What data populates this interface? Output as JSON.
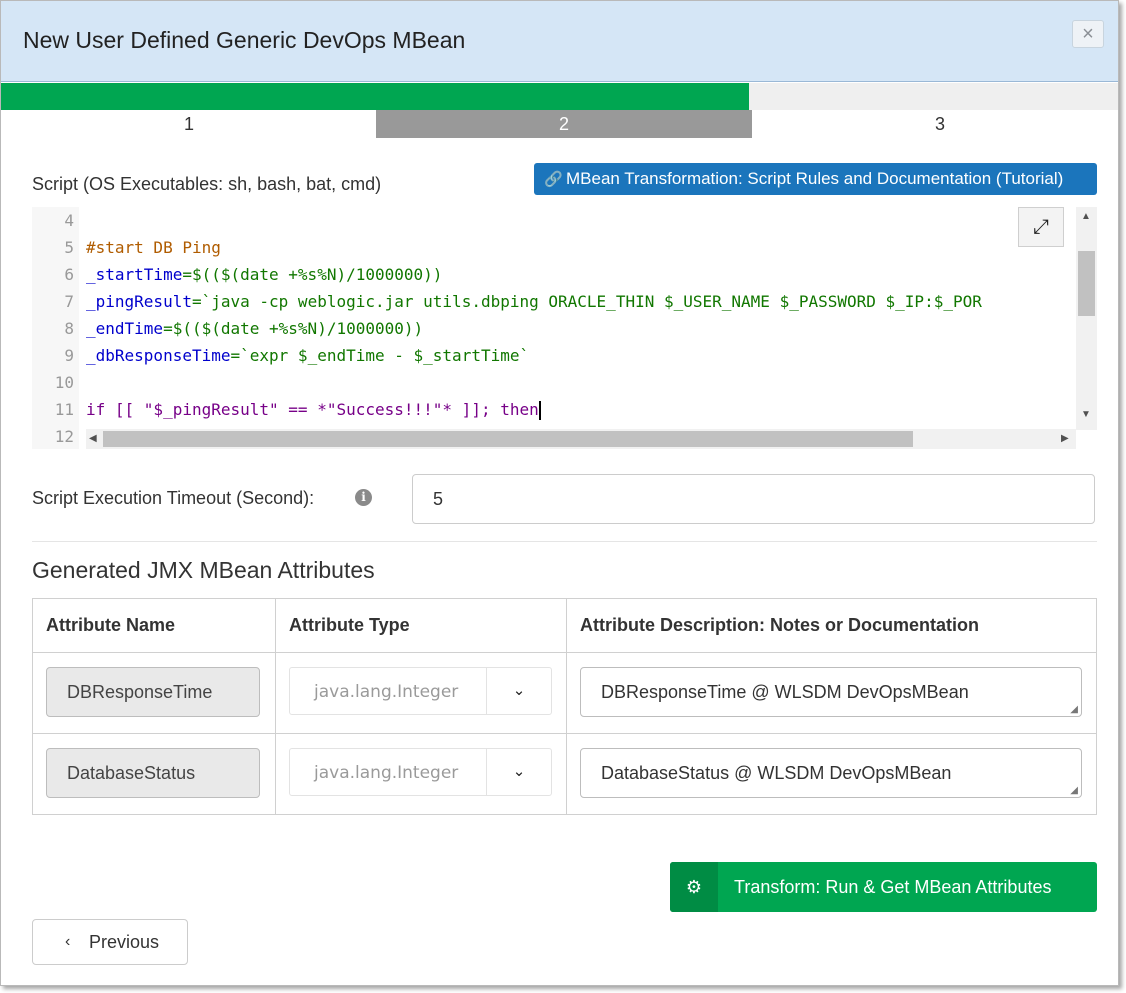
{
  "dialog": {
    "title": "New User Defined Generic DevOps MBean",
    "close_label": "×"
  },
  "progress": {
    "percent": 67,
    "fill_color": "#00a651"
  },
  "steps": [
    {
      "label": "1",
      "active": false
    },
    {
      "label": "2",
      "active": true
    },
    {
      "label": "3",
      "active": false
    }
  ],
  "script": {
    "label": "Script (OS Executables: sh, bash, bat, cmd)",
    "tutorial_button": "MBean Transformation: Script Rules and Documentation (Tutorial)",
    "tutorial_icon": "link-icon",
    "expand_icon": "expand-icon",
    "lines": [
      {
        "n": "4"
      },
      {
        "n": "5",
        "text": "#start DB Ping"
      },
      {
        "n": "6",
        "var": "_startTime",
        "rest": "=$(($(date +%s%N)/1000000))"
      },
      {
        "n": "7",
        "var": "_pingResult",
        "rest": "=`java -cp weblogic.jar utils.dbping ORACLE_THIN $_USER_NAME $_PASSWORD $_IP:$_POR"
      },
      {
        "n": "8",
        "var": "_endTime",
        "rest": "=$(($(date +%s%N)/1000000))"
      },
      {
        "n": "9",
        "var": "_dbResponseTime",
        "rest": "=`expr $_endTime - $_startTime`"
      },
      {
        "n": "10"
      },
      {
        "n": "11",
        "text": "if [[ \"$_pingResult\" == *\"Success!!!\"* ]]; then"
      },
      {
        "n": "12"
      }
    ]
  },
  "timeout": {
    "label": "Script Execution Timeout (Second):",
    "info_icon": "info-icon",
    "value": "5"
  },
  "attributes": {
    "section_title": "Generated JMX MBean Attributes",
    "columns": [
      "Attribute Name",
      "Attribute Type",
      "Attribute Description: Notes or Documentation"
    ],
    "rows": [
      {
        "name": "DBResponseTime",
        "type": "java.lang.Integer",
        "description": "DBResponseTime @ WLSDM DevOpsMBean"
      },
      {
        "name": "DatabaseStatus",
        "type": "java.lang.Integer",
        "description": "DatabaseStatus @ WLSDM DevOpsMBean"
      }
    ]
  },
  "actions": {
    "transform_button": "Transform: Run & Get MBean Attributes",
    "transform_icon": "gears-icon",
    "previous_button": "Previous",
    "previous_icon": "chevron-left-icon"
  }
}
